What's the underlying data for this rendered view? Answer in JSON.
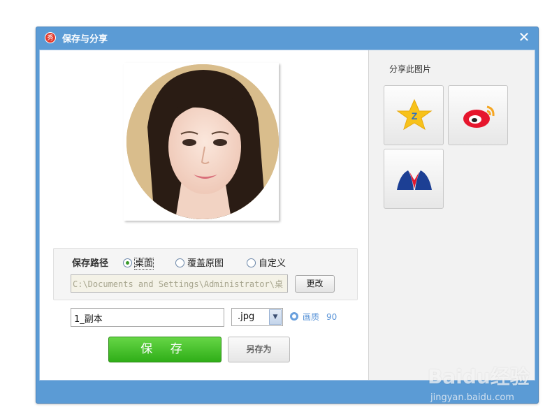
{
  "window": {
    "title": "保存与分享",
    "app_icon_glyph": "秀",
    "close_glyph": "✕"
  },
  "save_path": {
    "label": "保存路径",
    "options": [
      {
        "label": "桌面",
        "selected": true
      },
      {
        "label": "覆盖原图",
        "selected": false
      },
      {
        "label": "自定义",
        "selected": false
      }
    ],
    "path_value": "C:\\Documents and Settings\\Administrator\\桌",
    "change_button": "更改"
  },
  "file": {
    "name_value": "1_副本",
    "format_value": ".jpg",
    "quality_label": "画质",
    "quality_value": "90"
  },
  "buttons": {
    "save": "保 存",
    "save_as": "另存为"
  },
  "share": {
    "title": "分享此图片",
    "targets": [
      {
        "icon": "qzone-icon"
      },
      {
        "icon": "sina-weibo-icon"
      },
      {
        "icon": "renren-icon"
      }
    ]
  },
  "watermark": {
    "brand": "Baidu经验",
    "url": "jingyan.baidu.com"
  },
  "colors": {
    "title_bar": "#5b9bd5",
    "save_green": "#2fae18",
    "quality_link": "#5b95d8"
  }
}
